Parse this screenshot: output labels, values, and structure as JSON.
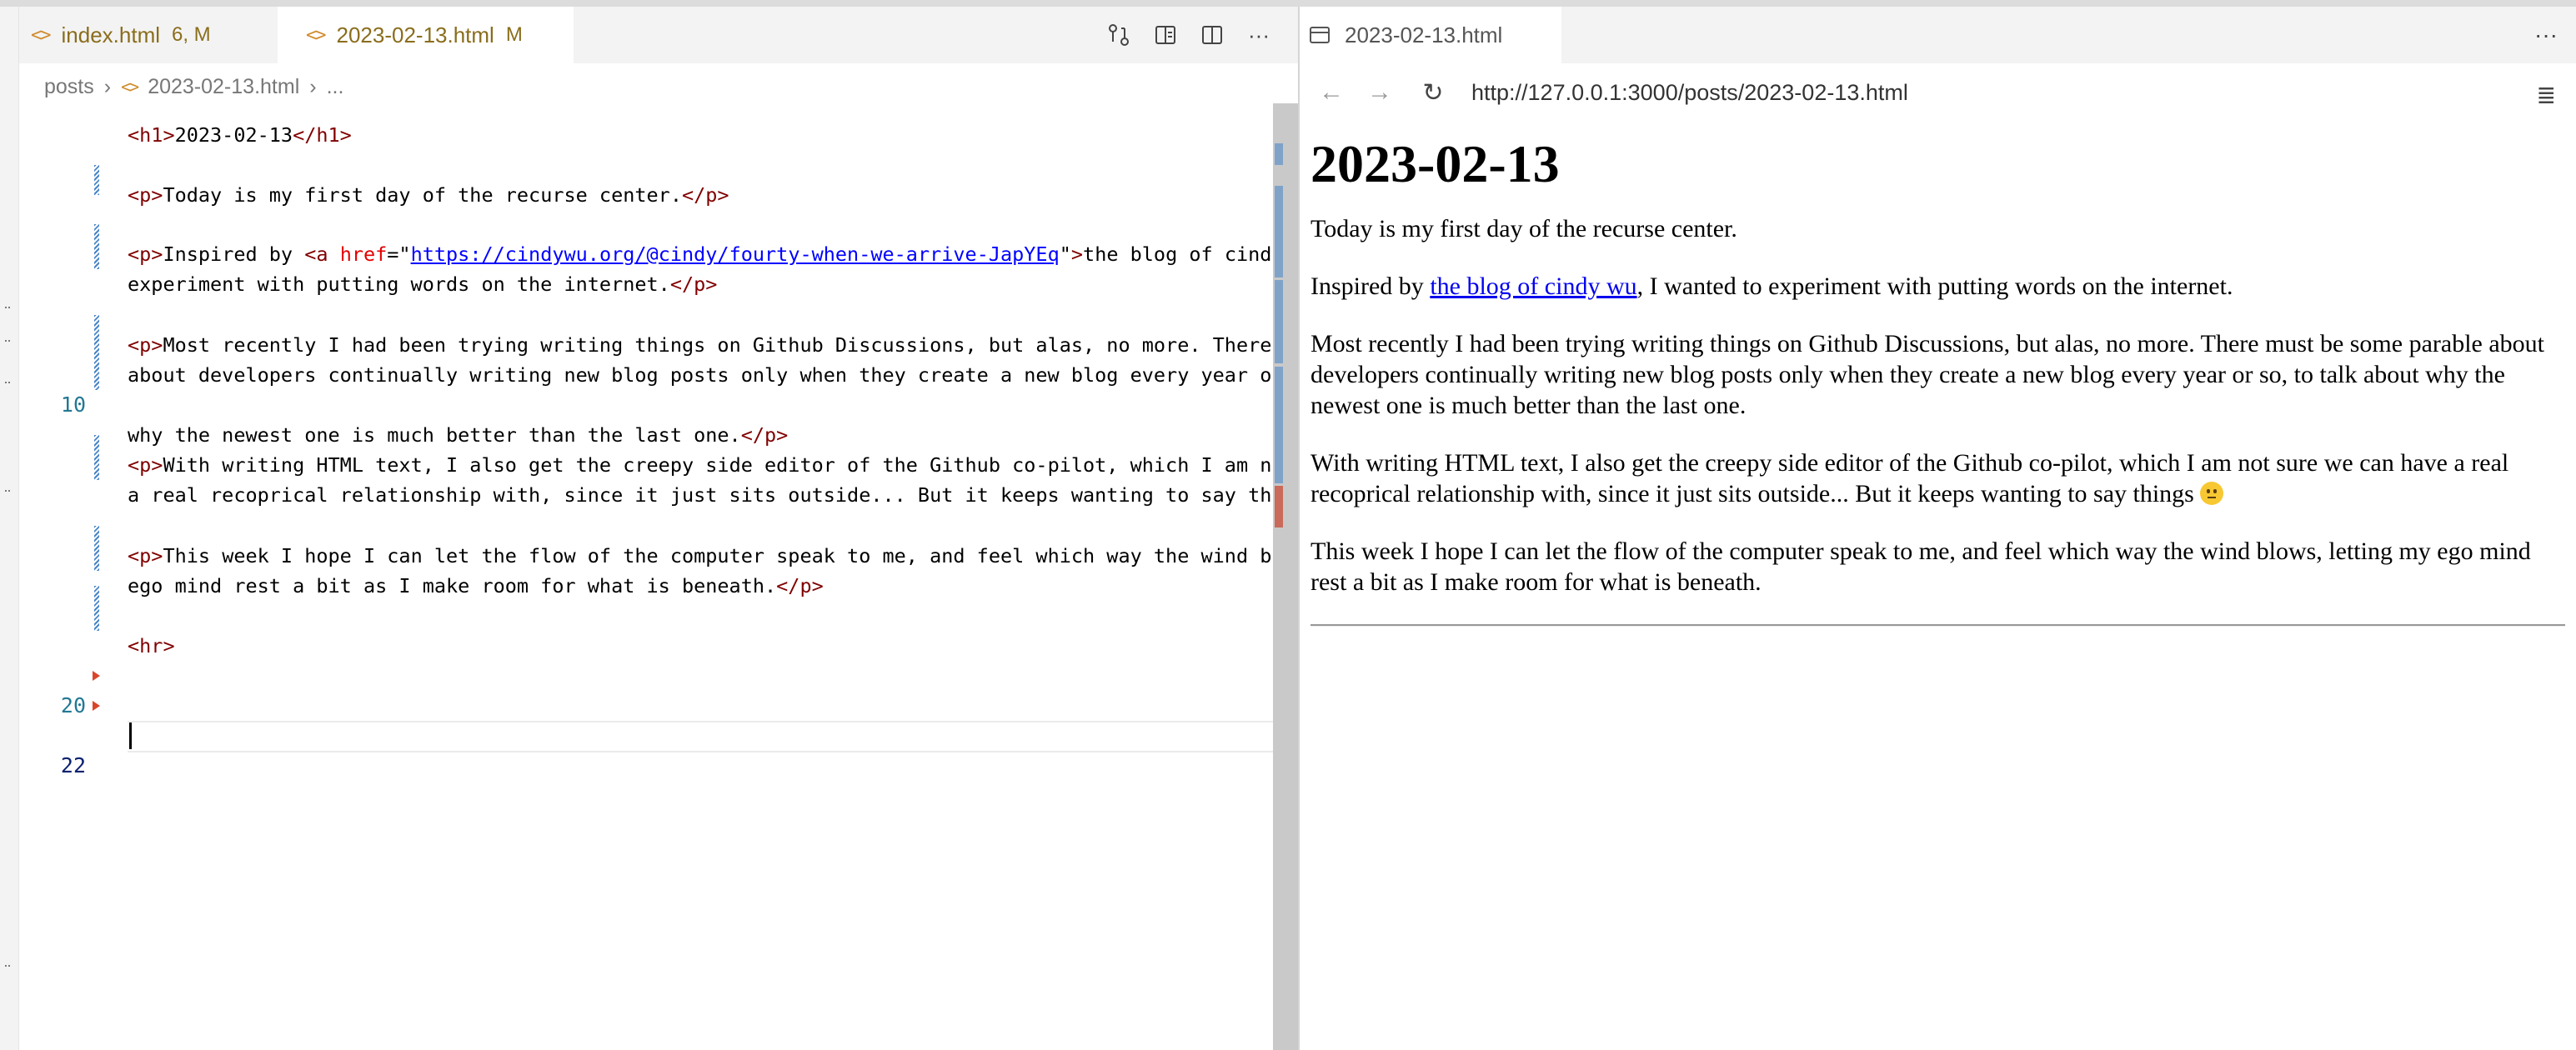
{
  "editor": {
    "tabs": [
      {
        "label": "index.html",
        "status": "6, M",
        "active": false
      },
      {
        "label": "2023-02-13.html",
        "status": "M",
        "active": true
      }
    ],
    "breadcrumb": [
      "posts",
      "2023-02-13.html",
      "..."
    ],
    "line_numbers": [
      "10",
      "20",
      "22"
    ],
    "lines": {
      "h1_open": "<h1>",
      "h1_text": "2023-02-13",
      "h1_close": "</h1>",
      "p1_text": "Today is my first day of the recurse center.",
      "p2_text_a": "Inspired by ",
      "p2_a_open": "<a ",
      "p2_attr": "href",
      "p2_eq": "=\"",
      "p2_url": "https://cindywu.org/@cindy/fourty-when-we-arrive-JapYEq",
      "p2_quote": "\"",
      "p2_a_close": ">",
      "p2_text_b": "the blog of cind",
      "p2_line2": "experiment with putting words on the internet.",
      "p3_text": "Most recently I had been trying writing things on Github Discussions, but alas, no more. There",
      "p3_line2": "about developers continually writing new blog posts only when they create a new blog every year o",
      "p3_line3": "why the newest one is much better than the last one.",
      "p4_text": "With writing HTML text, I also get the creepy side editor of the Github co-pilot, which I am n",
      "p4_line2": "a real recoprical relationship with, since it just sits outside... But it keeps wanting to say th",
      "p5_text": "This week I hope I can let the flow of the computer speak to me, and feel which way the wind b",
      "p5_line2": "ego mind rest a bit as I make room for what is beneath.",
      "p_open": "<p>",
      "p_close": "</p>",
      "hr": "<hr>"
    }
  },
  "preview": {
    "tab_label": "2023-02-13.html",
    "url": "http://127.0.0.1:3000/posts/2023-02-13.html",
    "heading": "2023-02-13",
    "p1": "Today is my first day of the recurse center.",
    "p2_before": "Inspired by ",
    "p2_link": "the blog of cindy wu",
    "p2_after": ", I wanted to experiment with putting words on the internet.",
    "p3": "Most recently I had been trying writing things on Github Discussions, but alas, no more. There must be some parable about developers continually writing new blog posts only when they create a new blog every year or so, to talk about why the newest one is much better than the last one.",
    "p4": "With writing HTML text, I also get the creepy side editor of the Github co-pilot, which I am not sure we can have a real recoprical relationship with, since it just sits outside... But it keeps wanting to say things",
    "p5": "This week I hope I can let the flow of the computer speak to me, and feel which way the wind blows, letting my ego mind rest a bit as I make room for what is beneath."
  },
  "icons": {
    "editor_actions": [
      "source-control-compare-icon",
      "open-preview-icon",
      "split-editor-icon",
      "more-actions-icon"
    ],
    "preview_actions": [
      "more-actions-icon",
      "menu-icon"
    ],
    "nav": [
      "back-icon",
      "forward-icon",
      "refresh-icon"
    ]
  },
  "colors": {
    "tag": "#800000",
    "attr": "#e50000",
    "string": "#0000ff",
    "line_number": "#237893",
    "modified": "#8a6d1c"
  }
}
